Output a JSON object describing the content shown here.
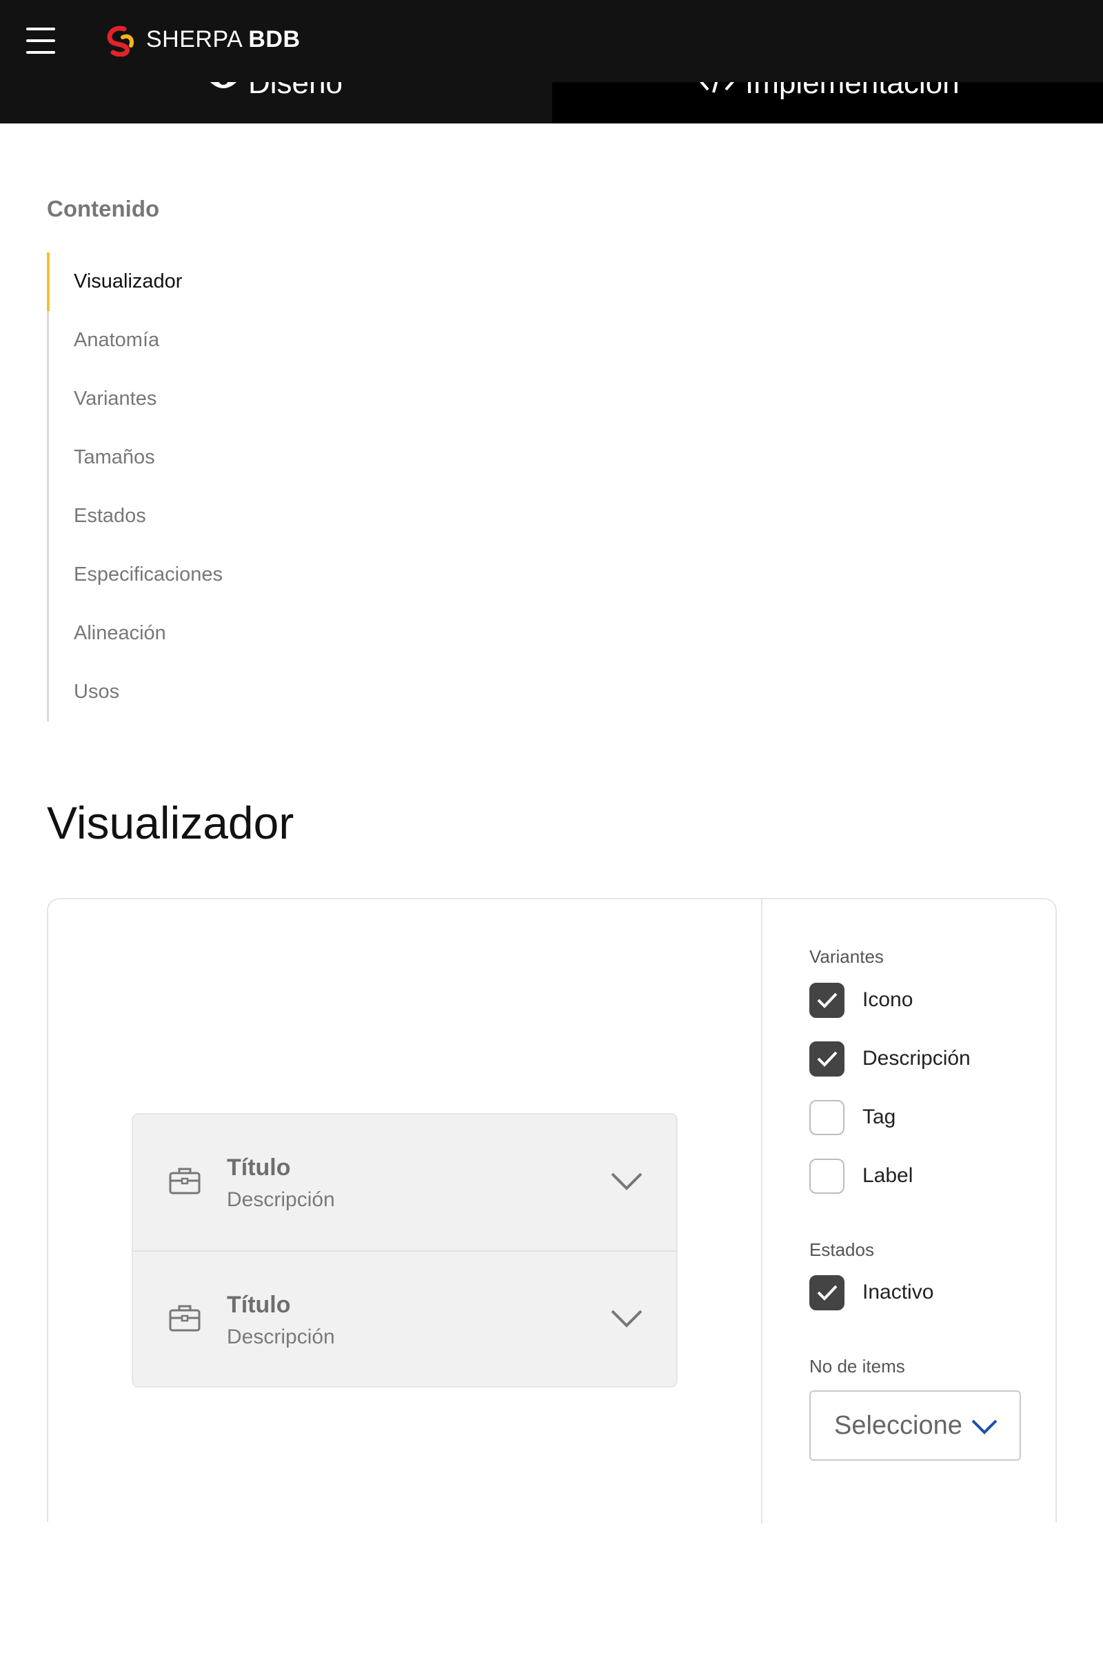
{
  "header": {
    "menu_icon": "hamburger-icon",
    "logo_icon": "sherpa-logo-icon",
    "brand_light": "SHERPA",
    "brand_bold": "BDB",
    "colors": {
      "background": "#121212",
      "logo_red": "#e0242a",
      "logo_yellow": "#f5b323"
    }
  },
  "tabs": [
    {
      "label": "Diseño",
      "icon": "eye-icon"
    },
    {
      "label": "Implementación",
      "icon": "code-icon"
    }
  ],
  "toc": {
    "heading": "Contenido",
    "active_color": "#f2c230",
    "items": [
      {
        "label": "Visualizador",
        "active": true
      },
      {
        "label": "Anatomía",
        "active": false
      },
      {
        "label": "Variantes",
        "active": false
      },
      {
        "label": "Tamaños",
        "active": false
      },
      {
        "label": "Estados",
        "active": false
      },
      {
        "label": "Especificaciones",
        "active": false
      },
      {
        "label": "Alineación",
        "active": false
      },
      {
        "label": "Usos",
        "active": false
      }
    ]
  },
  "section_title": "Visualizador",
  "preview": {
    "items": [
      {
        "title": "Título",
        "description": "Descripción",
        "icon": "briefcase-icon"
      },
      {
        "title": "Título",
        "description": "Descripción",
        "icon": "briefcase-icon"
      }
    ]
  },
  "controls": {
    "variants_label": "Variantes",
    "variants": [
      {
        "label": "Icono",
        "checked": true
      },
      {
        "label": "Descripción",
        "checked": true
      },
      {
        "label": "Tag",
        "checked": false
      },
      {
        "label": "Label",
        "checked": false
      }
    ],
    "states_label": "Estados",
    "states": [
      {
        "label": "Inactivo",
        "checked": true
      }
    ],
    "items_label": "No de items",
    "items_select_value": "Seleccione",
    "select_accent": "#1a4fb0"
  }
}
